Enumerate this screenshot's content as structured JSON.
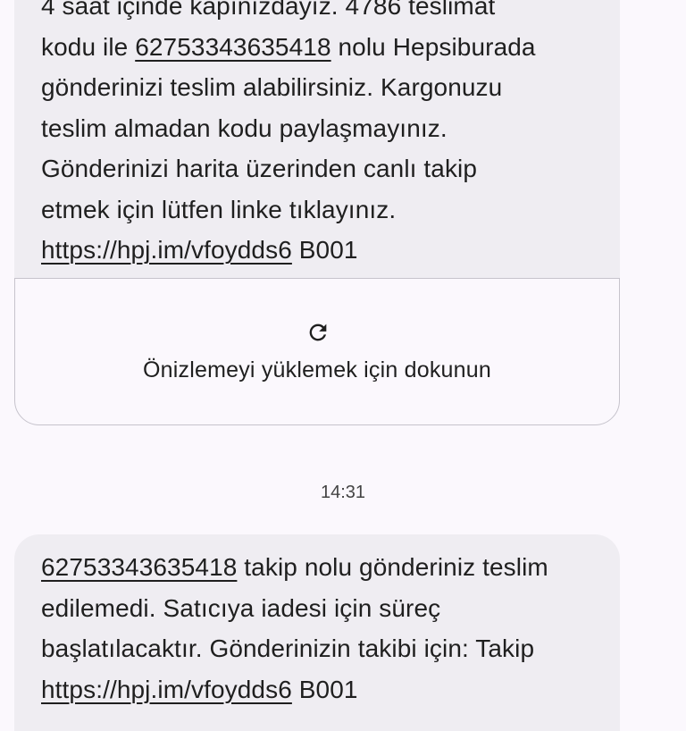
{
  "message1": {
    "lines": [
      "4 saat içinde kapınızdayız. 4786 teslimat",
      "kodu ile ",
      "62753343635418",
      " nolu Hepsiburada",
      "gönderinizi teslim alabilirsiniz. Kargonuzu",
      "teslim almadan kodu paylaşmayınız.",
      "Gönderinizi harita üzerinden canlı takip",
      "etmek için lütfen linke tıklayınız.",
      "https://hpj.im/vfoydds6",
      " B001"
    ]
  },
  "preview": {
    "icon": "refresh-icon",
    "label": "Önizlemeyi yüklemek için dokunun"
  },
  "timestamp": "14:31",
  "message2": {
    "tracking_link": "62753343635418",
    "line1_rest": " takip nolu gönderiniz teslim",
    "line2": "edilemedi. Satıcıya iadesi için süreç",
    "line3": "başlatılacaktır. Gönderinizin takibi için: Takip",
    "line4_link": "https://hpj.im/vfoydds6",
    "line4_rest": " B001"
  },
  "colors": {
    "background": "#fbf8fd",
    "bubble": "#efedf2",
    "card_border": "#c6c3cc",
    "text": "#1f1f1f"
  }
}
